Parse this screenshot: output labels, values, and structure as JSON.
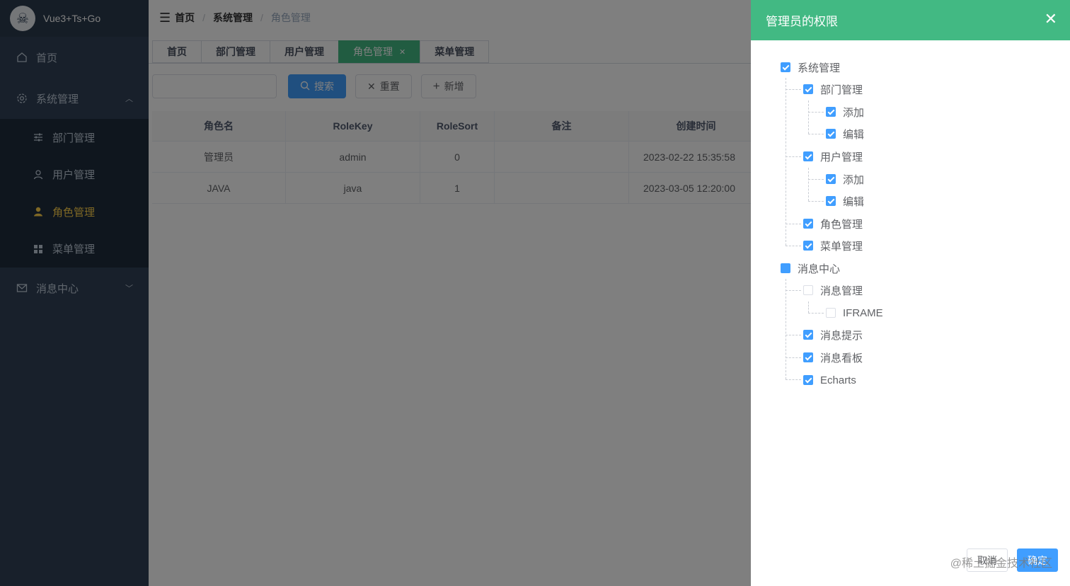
{
  "app": {
    "title": "Vue3+Ts+Go",
    "logo_icon": "skull-pirate-logo"
  },
  "sidebar": {
    "items": [
      {
        "label": "首页",
        "icon": "home-icon"
      },
      {
        "label": "系统管理",
        "icon": "gear-icon",
        "expanded": true,
        "children": [
          {
            "label": "部门管理",
            "icon": "sliders-icon"
          },
          {
            "label": "用户管理",
            "icon": "user-icon"
          },
          {
            "label": "角色管理",
            "icon": "user-filled-icon",
            "active": true
          },
          {
            "label": "菜单管理",
            "icon": "grid-icon"
          }
        ]
      },
      {
        "label": "消息中心",
        "icon": "mail-icon",
        "expanded": false
      }
    ],
    "colors": {
      "bg": "#304156",
      "submenu_bg": "#1f2d3d",
      "text": "#bfcbd9",
      "active": "#ffd04b"
    }
  },
  "breadcrumb": [
    "首页",
    "系统管理",
    "角色管理"
  ],
  "tags": [
    {
      "label": "首页"
    },
    {
      "label": "部门管理"
    },
    {
      "label": "用户管理"
    },
    {
      "label": "角色管理",
      "active": true
    },
    {
      "label": "菜单管理"
    }
  ],
  "toolbar": {
    "search_placeholder": "",
    "search_label": "搜索",
    "reset_label": "重置",
    "add_label": "新增"
  },
  "table": {
    "columns": [
      "角色名",
      "RoleKey",
      "RoleSort",
      "备注",
      "创建时间"
    ],
    "rows": [
      [
        "管理员",
        "admin",
        "0",
        "",
        "2023-02-22 15:35:58"
      ],
      [
        "JAVA",
        "java",
        "1",
        "",
        "2023-03-05 12:20:00"
      ]
    ]
  },
  "drawer": {
    "title": "管理员的权限",
    "tree": [
      {
        "label": "系统管理",
        "state": "checked"
      },
      {
        "label": "部门管理",
        "state": "checked"
      },
      {
        "label": "添加",
        "state": "checked"
      },
      {
        "label": "编辑",
        "state": "checked"
      },
      {
        "label": "用户管理",
        "state": "checked"
      },
      {
        "label": "添加",
        "state": "checked"
      },
      {
        "label": "编辑",
        "state": "checked"
      },
      {
        "label": "角色管理",
        "state": "checked"
      },
      {
        "label": "菜单管理",
        "state": "checked"
      },
      {
        "label": "消息中心",
        "state": "indeterminate"
      },
      {
        "label": "消息管理",
        "state": "unchecked"
      },
      {
        "label": "IFRAME",
        "state": "unchecked"
      },
      {
        "label": "消息提示",
        "state": "checked"
      },
      {
        "label": "消息看板",
        "state": "checked"
      },
      {
        "label": "Echarts",
        "state": "checked"
      }
    ],
    "cancel_label": "取消",
    "confirm_label": "确定",
    "header_color": "#42b983"
  },
  "watermark": "@稀土掘金技术社区"
}
